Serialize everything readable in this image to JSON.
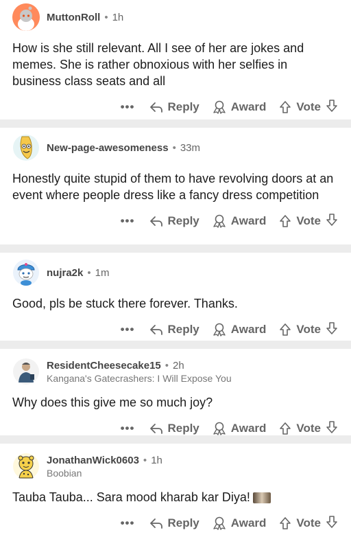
{
  "actions": {
    "more": "•••",
    "reply": "Reply",
    "award": "Award",
    "vote": "Vote"
  },
  "comments": [
    {
      "user": "MuttonRoll",
      "time": "1h",
      "flair": "",
      "text": "How is she still relevant. All I see of her are jokes and memes. She is rather obnoxious with her selfies in business class seats and all",
      "avatar_color": "#ff8a5c"
    },
    {
      "user": "New-page-awesomeness",
      "time": "33m",
      "flair": "",
      "text": "Honestly quite stupid of them to have revolving doors at an event where people dress like a fancy dress competition",
      "avatar_color": "#f5c84b"
    },
    {
      "user": "nujra2k",
      "time": "1m",
      "flair": "",
      "text": "Good, pls be stuck there forever. Thanks.",
      "avatar_color": "#3d8fd6"
    },
    {
      "user": "ResidentCheesecake15",
      "time": "2h",
      "flair": "Kangana's Gatecrashers: I Will Expose You",
      "text": "Why does this give me so much joy?",
      "avatar_color": "#d8d8d8"
    },
    {
      "user": "JonathanWick0603",
      "time": "1h",
      "flair": "Boobian",
      "text": "Tauba Tauba... Sara mood kharab kar Diya!",
      "avatar_color": "#f6d14a"
    }
  ]
}
